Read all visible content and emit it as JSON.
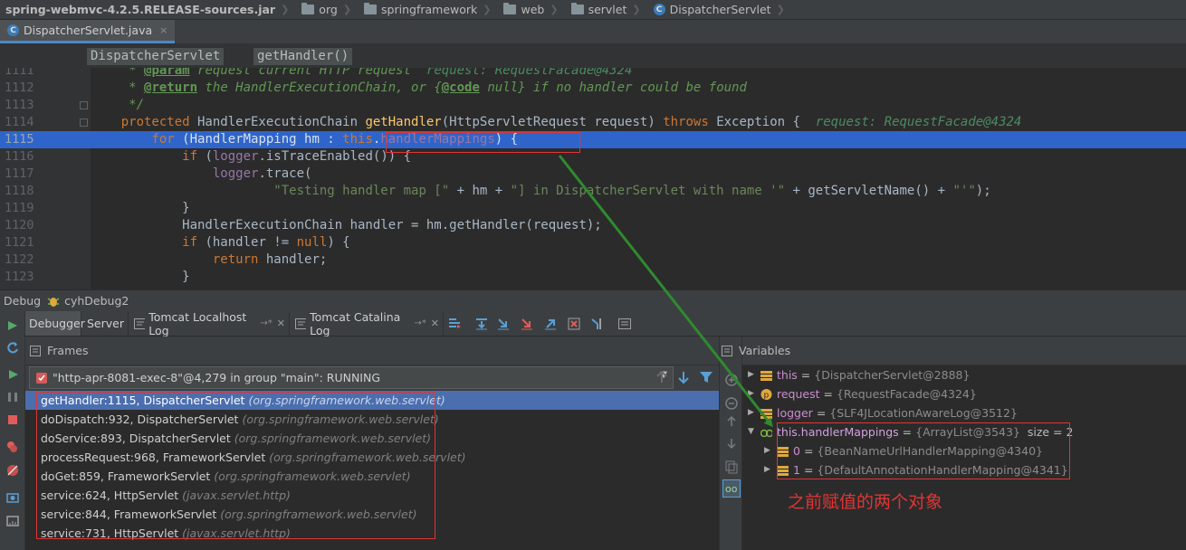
{
  "breadcrumb": {
    "items": [
      {
        "label": "spring-webmvc-4.2.5.RELEASE-sources.jar",
        "icon": "none"
      },
      {
        "label": "org",
        "icon": "folder-icon"
      },
      {
        "label": "springframework",
        "icon": "folder-icon"
      },
      {
        "label": "web",
        "icon": "folder-icon"
      },
      {
        "label": "servlet",
        "icon": "folder-icon"
      },
      {
        "label": "DispatcherServlet",
        "icon": "class-icon"
      }
    ]
  },
  "file_tab": {
    "label": "DispatcherServlet.java",
    "close": "×"
  },
  "method_breadcrumb": {
    "class_label": "DispatcherServlet",
    "method_label": "getHandler()"
  },
  "editor": {
    "lines": [
      {
        "num": "1111"
      },
      {
        "num": "1112"
      },
      {
        "num": "1113"
      },
      {
        "num": "1114"
      },
      {
        "num": "1115"
      },
      {
        "num": "1116"
      },
      {
        "num": "1117"
      },
      {
        "num": "1118"
      },
      {
        "num": "1119"
      },
      {
        "num": "1120"
      },
      {
        "num": "1121"
      },
      {
        "num": "1122"
      },
      {
        "num": "1123"
      }
    ],
    "highlighted_line": "1115"
  },
  "debug": {
    "header_label": "Debug",
    "config_name": "cyhDebug2",
    "tabs": [
      {
        "label": "Debugger"
      },
      {
        "label": "Server"
      },
      {
        "label": "Tomcat Localhost Log",
        "suffix": "→*"
      },
      {
        "label": "Tomcat Catalina Log",
        "suffix": "→*"
      }
    ],
    "frames": {
      "title": "Frames",
      "thread": "\"http-apr-8081-exec-8\"@4,279 in group \"main\": RUNNING",
      "items": [
        {
          "method": "getHandler:1115, DispatcherServlet",
          "pkg": "(org.springframework.web.servlet)"
        },
        {
          "method": "doDispatch:932, DispatcherServlet",
          "pkg": "(org.springframework.web.servlet)"
        },
        {
          "method": "doService:893, DispatcherServlet",
          "pkg": "(org.springframework.web.servlet)"
        },
        {
          "method": "processRequest:968, FrameworkServlet",
          "pkg": "(org.springframework.web.servlet)"
        },
        {
          "method": "doGet:859, FrameworkServlet",
          "pkg": "(org.springframework.web.servlet)"
        },
        {
          "method": "service:624, HttpServlet",
          "pkg": "(javax.servlet.http)"
        },
        {
          "method": "service:844, FrameworkServlet",
          "pkg": "(org.springframework.web.servlet)"
        },
        {
          "method": "service:731, HttpServlet",
          "pkg": "(javax.servlet.http)"
        }
      ]
    },
    "variables": {
      "title": "Variables",
      "items": [
        {
          "name": "this",
          "value": "{DispatcherServlet@2888}"
        },
        {
          "name": "request",
          "value": "{RequestFacade@4324}"
        },
        {
          "name": "logger",
          "value": "{SLF4JLocationAwareLog@3512}"
        },
        {
          "name": "this.handlerMappings",
          "value": "{ArrayList@3543}",
          "extra": "size = 2"
        },
        {
          "name": "0",
          "value": "{BeanNameUrlHandlerMapping@4340}"
        },
        {
          "name": "1",
          "value": "{DefaultAnnotationHandlerMapping@4341}"
        }
      ]
    }
  },
  "annotation": "之前赋值的两个对象",
  "colors": {
    "highlight": "#2f65ca",
    "frame_selected": "#4b6eaf",
    "annotation_red": "#e03535",
    "arrow_green": "#2f8a2f"
  }
}
